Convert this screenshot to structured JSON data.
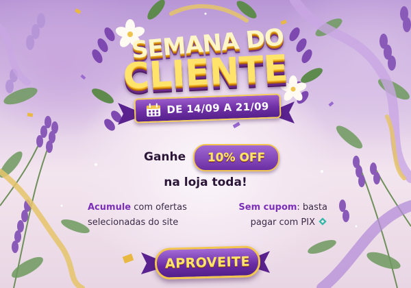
{
  "headline": {
    "line1": "SEMANA DO",
    "line2": "CLIENTE"
  },
  "date_range": "DE 14/09 A 21/09",
  "offer": {
    "prefix": "Ganhe",
    "badge": "10% OFF",
    "suffix": "na loja toda!"
  },
  "features": {
    "left": {
      "highlight": "Acumule",
      "text_line1": "com ofertas",
      "text_line2": "selecionadas do site"
    },
    "right": {
      "highlight": "Sem cupom",
      "text_line1": ": basta",
      "text_line2": "pagar com PIX"
    }
  },
  "cta_label": "APROVEITE",
  "colors": {
    "purple": "#7b2fb8",
    "gold": "#f2c64e",
    "yellow_text": "#ffe46a",
    "dark_text": "#2b1638"
  },
  "icons": [
    "calendar-icon",
    "pix-icon",
    "lavender-decoration",
    "ribbon-decoration",
    "flower-decoration"
  ]
}
